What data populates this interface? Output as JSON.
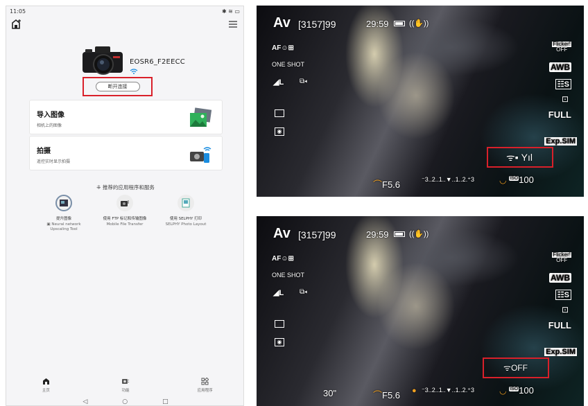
{
  "phone": {
    "status_time": "11:05",
    "status_icons": "✱ ≋ ▭",
    "camera_name": "EOSR6_F2EECC",
    "disconnect_label": "断开连接",
    "cards": [
      {
        "title": "导入图像",
        "subtitle": "相机上的图像"
      },
      {
        "title": "拍摄",
        "subtitle": "遥控实时显示拍摄"
      }
    ],
    "recommended_title": "推荐的应用程序和服务",
    "recommended_apps": [
      {
        "label1": "提升图像",
        "label2": "Neural network",
        "label3": "Upscaling Tool"
      },
      {
        "label1": "使用 FTP 标记和传输图像",
        "label2": "Mobile File Transfer",
        "label3": ""
      },
      {
        "label1": "使用 SELPHY 打印",
        "label2": "SELPHY Photo Layout",
        "label3": ""
      }
    ],
    "nav": [
      {
        "label": "主页",
        "icon": "home-icon"
      },
      {
        "label": "功能",
        "icon": "camera-icon"
      },
      {
        "label": "应用程序",
        "icon": "apps-icon"
      }
    ],
    "sysnav": [
      "◁",
      "○",
      "□"
    ]
  },
  "viewfinders": [
    {
      "mode": "Av",
      "shots": "[3157]99",
      "time": "29:59",
      "af": "AF☺⊞",
      "oneshot": "ONE SHOT",
      "quality": "◢L",
      "drive": "⧉◂",
      "flicker_top": "Flicker!",
      "flicker_bottom": "OFF",
      "awb": "AWB",
      "picture_style": "☷S",
      "full": "FULL",
      "expsim": "Exp.SIM",
      "shutter": "",
      "aperture": "F5.6",
      "exposure_scale": "⁻3..2..1..▼..1..2.⁺3",
      "iso": "100",
      "iso_label": "ISO",
      "wifi": "ᯤ▪ Yıl"
    },
    {
      "mode": "Av",
      "shots": "[3157]99",
      "time": "29:59",
      "af": "AF☺⊞",
      "oneshot": "ONE SHOT",
      "quality": "◢L",
      "drive": "⧉◂",
      "flicker_top": "Flicker!",
      "flicker_bottom": "OFF",
      "awb": "AWB",
      "picture_style": "☷S",
      "full": "FULL",
      "expsim": "Exp.SIM",
      "shutter": "30\"",
      "aperture": "F5.6",
      "exposure_scale": "⁻3..2..1..▼..1..2.⁺3",
      "iso": "100",
      "iso_label": "ISO",
      "wifi": "ᯤOFF"
    }
  ]
}
